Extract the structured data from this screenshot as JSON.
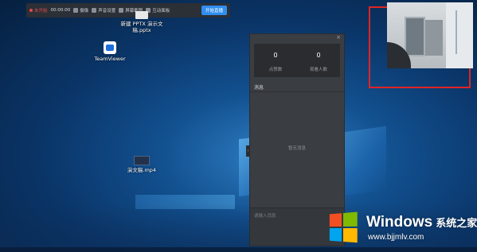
{
  "toolbar": {
    "status": "未开始",
    "timer": "00:00:00",
    "items": [
      "摄像",
      "声音设置",
      "屏幕截图",
      "互动面板"
    ],
    "live_button": "开始直播"
  },
  "desktop": {
    "icons": [
      {
        "label": "新建 PPTX 演示文稿.pptx",
        "icon": "pptx-file-icon"
      },
      {
        "label": "TeamViewer",
        "icon": "teamviewer-icon"
      },
      {
        "label": "演文稿.mp4",
        "icon": "video-file-icon"
      }
    ]
  },
  "panel": {
    "close": "×",
    "stats": [
      {
        "value": "0",
        "label": "点赞数"
      },
      {
        "value": "0",
        "label": "观看人数"
      }
    ],
    "messages_title": "消息",
    "empty_text": "暂无消息",
    "input_placeholder": "请输入消息",
    "handle": "‹"
  },
  "watermark": {
    "title": "Windows",
    "title_cn": "系统之家",
    "url": "www.bjjmlv.com"
  },
  "colors": {
    "accent": "#2f8ef0",
    "status_red": "#e14b4b",
    "frame_red": "#e02424"
  }
}
